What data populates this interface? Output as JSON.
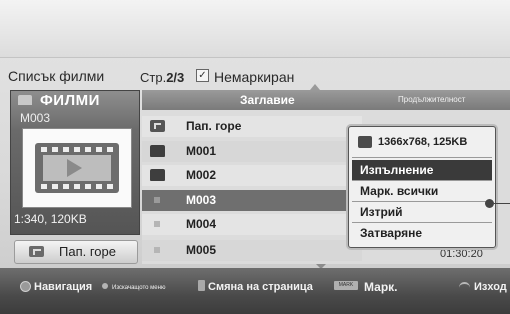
{
  "header": {
    "list_title": "Списък филми",
    "page_prefix": "Стр.",
    "page_number": "2/3",
    "filter_label": "Немаркиран"
  },
  "left_panel": {
    "folder_title": "ФИЛМИ",
    "current_file": "M003",
    "resolution_size": "1:340, 120KB",
    "up_button_label": "Пап. горе"
  },
  "table": {
    "col_title": "Заглавие",
    "col_duration": "Продължителност",
    "rows": [
      {
        "label": "Пап. горе",
        "icon": "folder-up-icon"
      },
      {
        "label": "M001",
        "icon": "folder-icon"
      },
      {
        "label": "M002",
        "icon": "folder-icon"
      },
      {
        "label": "M003",
        "icon": "file-icon",
        "selected": true
      },
      {
        "label": "M004",
        "icon": "file-icon"
      },
      {
        "label": "M005",
        "icon": "file-icon"
      }
    ],
    "visible_duration": "01:30:20"
  },
  "popup": {
    "info": "1366x768, 125KB",
    "items": [
      "Изпълнение",
      "Марк. всички",
      "Изтрий",
      "Затваряне"
    ],
    "active_index": 0
  },
  "footer": {
    "navigation": "Навигация",
    "popup_menu": "Изскачащото меню",
    "page_change": "Смяна на страница",
    "mark_key": "MARK",
    "mark": "Марк.",
    "exit": "Изход"
  }
}
